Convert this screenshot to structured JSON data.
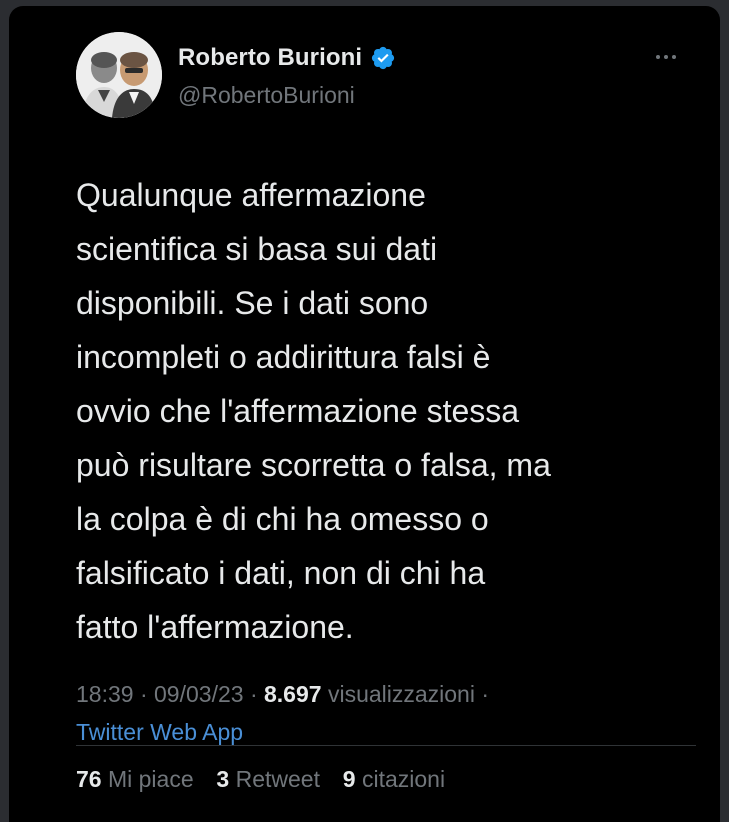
{
  "author": {
    "display_name": "Roberto Burioni",
    "handle": "@RobertoBurioni",
    "verified": true,
    "avatar_icon": "profile-photo"
  },
  "tweet": {
    "text": "Qualunque affermazione\nscientifica si basa sui dati\ndisponibili. Se i dati sono\nincompleti o addirittura falsi è\novvio che l'affermazione stessa\npuò risultare scorretta o falsa, ma\nla colpa è di chi ha omesso o\nfalsificato i dati, non di chi ha\nfatto l'affermazione."
  },
  "meta": {
    "time": "18:39",
    "separator": "·",
    "date": "09/03/23",
    "views_count": "8.697",
    "views_label": "visualizzazioni",
    "source": "Twitter Web App"
  },
  "stats": {
    "likes_count": "76",
    "likes_label": "Mi piace",
    "retweets_count": "3",
    "retweets_label": "Retweet",
    "quotes_count": "9",
    "quotes_label": "citazioni"
  },
  "colors": {
    "background": "#000000",
    "text": "#e7e9ea",
    "muted": "#71767b",
    "link": "#4a8fd6",
    "verified": "#1d9bf0"
  },
  "icons": {
    "verified": "verified-badge-icon",
    "more": "more-options-icon"
  }
}
